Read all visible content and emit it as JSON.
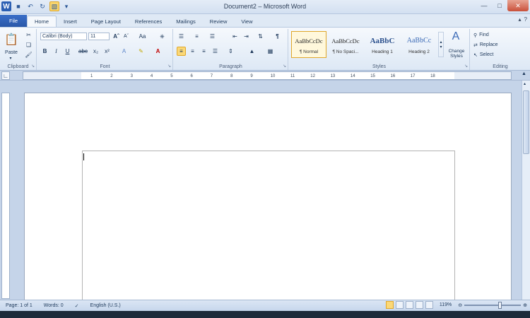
{
  "window": {
    "title": "Document2 – Microsoft Word",
    "qat_icons": [
      "save-icon",
      "undo-icon",
      "redo-icon",
      "format-painter-icon"
    ]
  },
  "tabs": [
    {
      "label": "File"
    },
    {
      "label": "Home",
      "selected": true
    },
    {
      "label": "Insert"
    },
    {
      "label": "Page Layout"
    },
    {
      "label": "References"
    },
    {
      "label": "Mailings"
    },
    {
      "label": "Review"
    },
    {
      "label": "View"
    }
  ],
  "ribbon": {
    "clipboard": {
      "label": "Clipboard",
      "paste": "Paste"
    },
    "font": {
      "label": "Font",
      "family": "Calibri (Body)",
      "size": "11"
    },
    "paragraph": {
      "label": "Paragraph"
    },
    "styles": {
      "label": "Styles",
      "items": [
        {
          "preview": "AaBbCcDc",
          "name": "¶ Normal",
          "active": true
        },
        {
          "preview": "AaBbCcDc",
          "name": "¶ No Spaci..."
        },
        {
          "preview": "AaBbC",
          "name": "Heading 1"
        },
        {
          "preview": "AaBbCc",
          "name": "Heading 2"
        }
      ],
      "change_styles": "Change Styles"
    },
    "editing": {
      "label": "Editing",
      "find": "Find",
      "replace": "Replace",
      "select": "Select"
    }
  },
  "ruler": {
    "ticks": [
      "1",
      "2",
      "3",
      "4",
      "5",
      "6",
      "7",
      "8",
      "9",
      "10",
      "11",
      "12",
      "13",
      "14",
      "15",
      "16",
      "17",
      "18"
    ]
  },
  "status": {
    "page": "Page: 1 of 1",
    "words": "Words: 0",
    "language": "English (U.S.)",
    "zoom": "119%"
  },
  "colors": {
    "accent": "#2b5797",
    "selected": "#fbd877"
  }
}
